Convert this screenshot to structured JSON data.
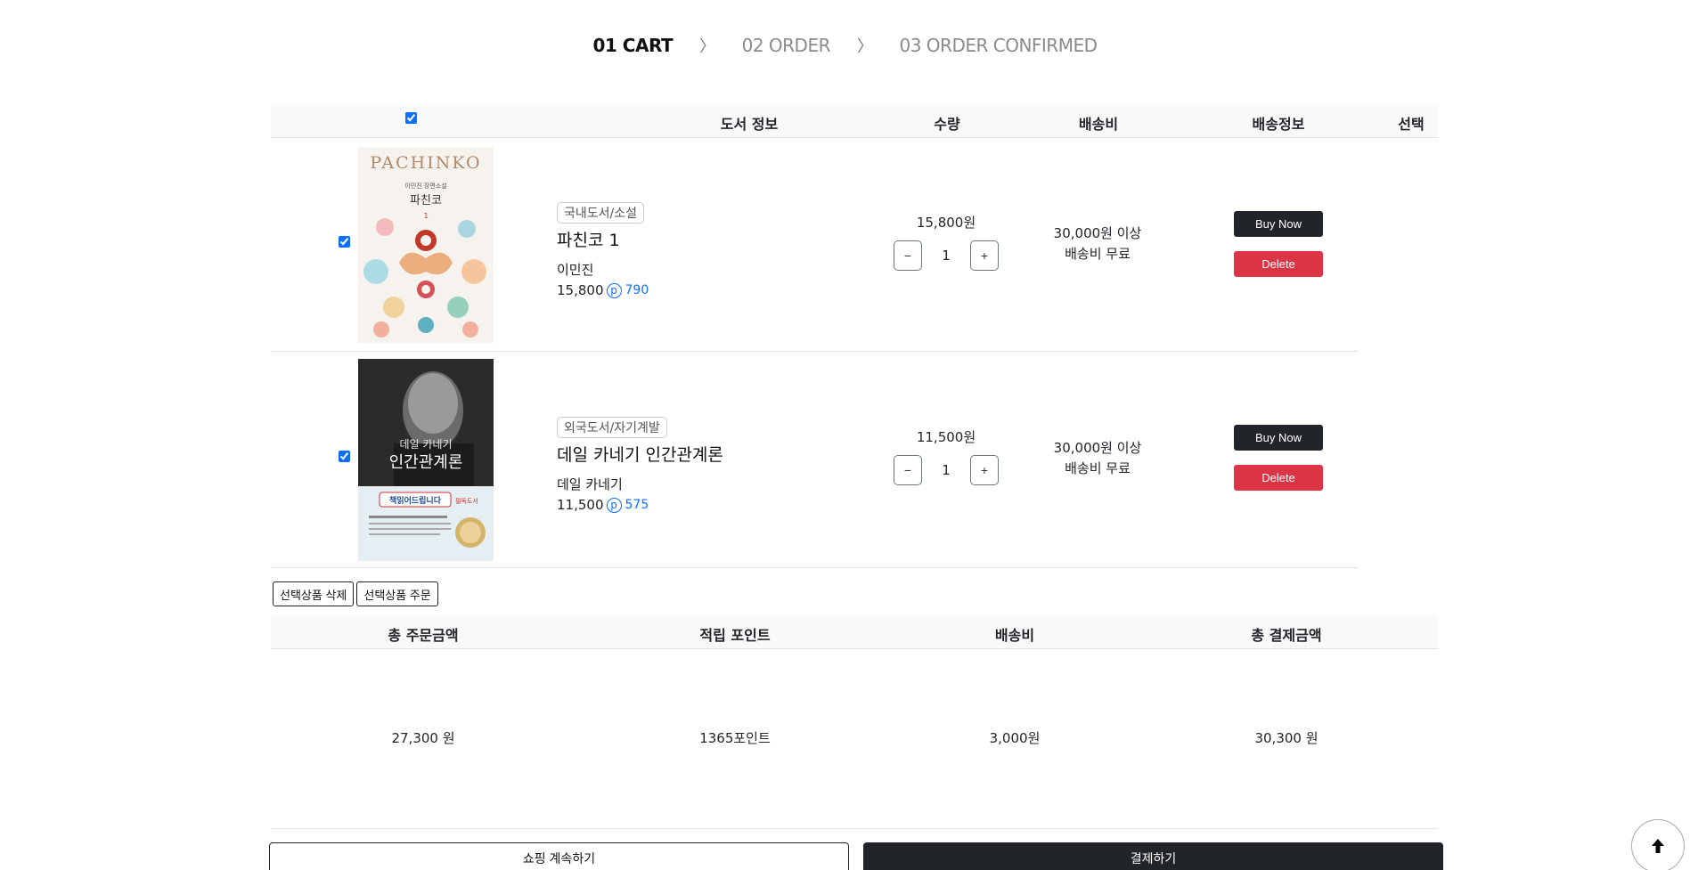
{
  "steps": {
    "step1": "01 CART",
    "sep1": "〉",
    "step2": "02 ORDER",
    "sep2": "〉",
    "step3": "03 ORDER CONFIRMED"
  },
  "table_header": {
    "book_info": "도서 정보",
    "quantity": "수량",
    "shipping_fee": "배송비",
    "shipping_info": "배송정보",
    "select": "선택"
  },
  "items": [
    {
      "checked": true,
      "cover_title": "PACHINKO",
      "cover_subtitle": "이민진 장편소설",
      "cover_kr_title": "파친코",
      "cover_volume": "1",
      "category": "국내도서/소설",
      "title": "파친코 1",
      "author": "이민진",
      "price": "15,800",
      "point_badge": "p",
      "points": "790",
      "unit_price": "15,800원",
      "quantity": "1",
      "minus": "−",
      "plus": "+",
      "ship_line1": "30,000원 이상",
      "ship_line2": "배송비 무료",
      "buy_label": "Buy Now",
      "delete_label": "Delete"
    },
    {
      "checked": true,
      "cover_title": "데일 카네기",
      "cover_subtitle": "인간관계론",
      "cover_banner": "책읽어드립니다",
      "cover_tag": "필독도서",
      "category": "외국도서/자기계발",
      "title": "데일 카네기 인간관계론",
      "author": "데일 카네기",
      "price": "11,500",
      "point_badge": "p",
      "points": "575",
      "unit_price": "11,500원",
      "quantity": "1",
      "minus": "−",
      "plus": "+",
      "ship_line1": "30,000원 이상",
      "ship_line2": "배송비 무료",
      "buy_label": "Buy Now",
      "delete_label": "Delete"
    }
  ],
  "selection_actions": {
    "delete_selected": "선택상품 삭제",
    "order_selected": "선택상품 주문"
  },
  "summary": {
    "headers": {
      "total_order": "총 주문금액",
      "points": "적립 포인트",
      "shipping": "배송비",
      "total_payment": "총 결제금액"
    },
    "values": {
      "total_order": "27,300 원",
      "points": "1365포인트",
      "shipping": "3,000원",
      "total_payment": "30,300 원"
    }
  },
  "footer": {
    "continue_label": "쇼핑 계속하기",
    "pay_label": "결제하기"
  },
  "colors": {
    "primary_dark": "#212529",
    "danger": "#dc3545",
    "accent_blue": "#0d6efd",
    "header_bg": "#f8f9fa"
  }
}
